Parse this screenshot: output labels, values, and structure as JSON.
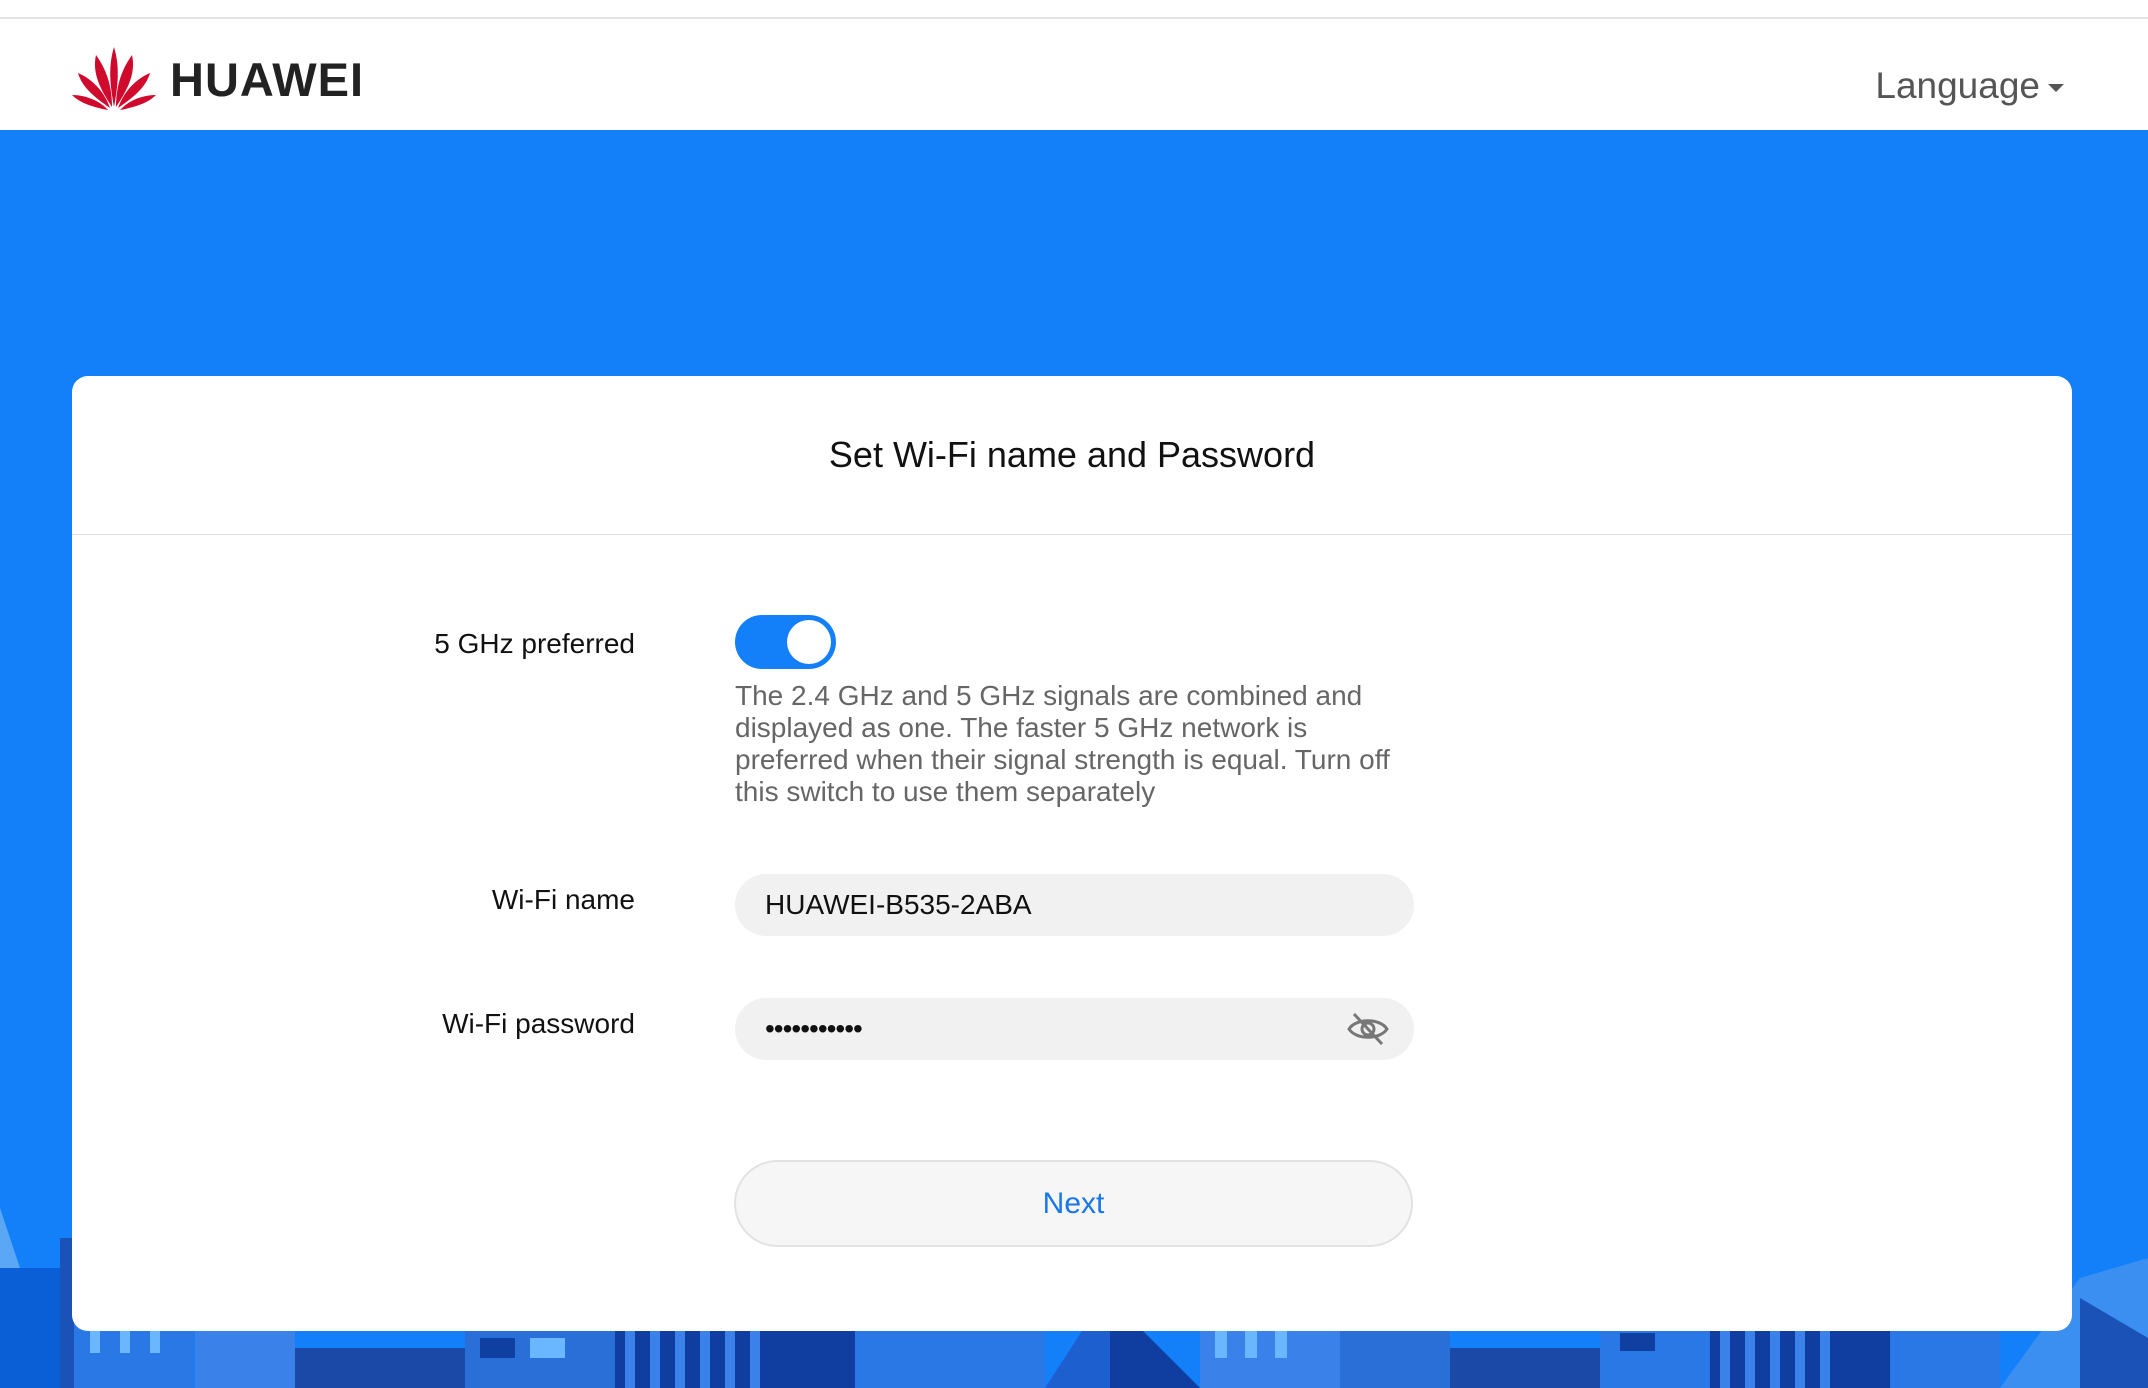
{
  "header": {
    "brand": "HUAWEI",
    "language_label": "Language"
  },
  "card": {
    "title": "Set Wi-Fi name and Password",
    "five_ghz": {
      "label": "5 GHz preferred",
      "enabled": true,
      "hint": "The 2.4 GHz and 5 GHz signals are combined and displayed as one. The faster 5 GHz network is preferred when their signal strength is equal. Turn off this switch to use them separately"
    },
    "wifi_name": {
      "label": "Wi-Fi name",
      "value": "HUAWEI-B535-2ABA"
    },
    "wifi_password": {
      "label": "Wi-Fi password",
      "masked_value": "•••••••••••"
    },
    "next_label": "Next"
  },
  "colors": {
    "accent": "#1380f9",
    "brand_red": "#cf0a2c"
  },
  "icons": {
    "logo": "huawei-petal-logo",
    "caret": "caret-down-icon",
    "eye": "eye-off-icon"
  }
}
